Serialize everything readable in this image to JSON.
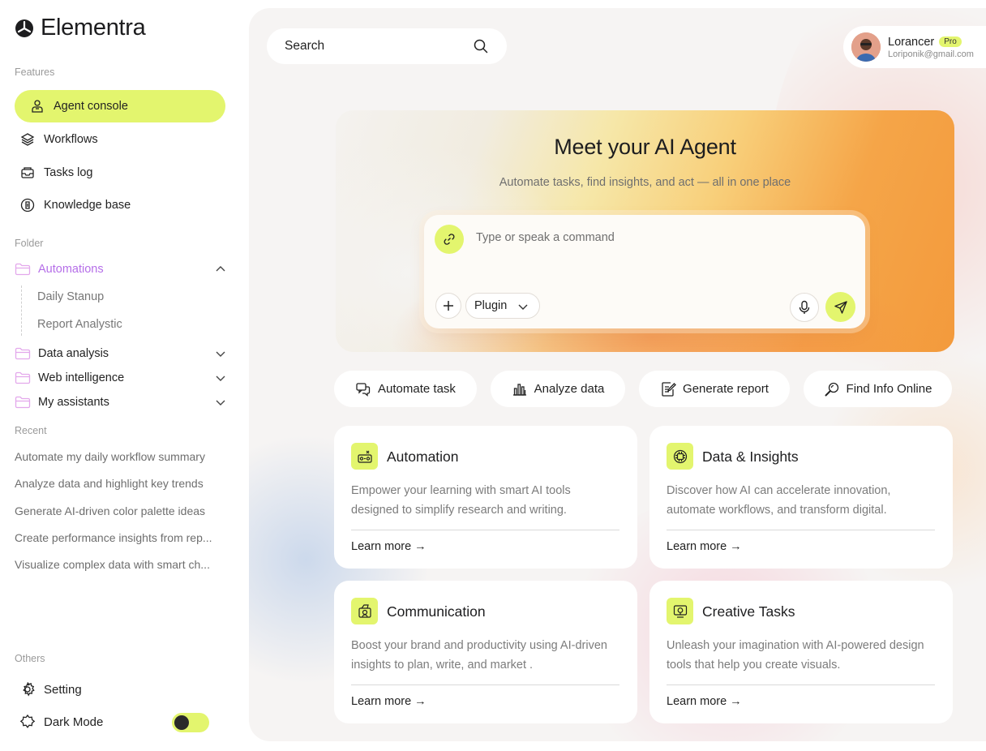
{
  "brand": {
    "name": "Elementra"
  },
  "sidebar": {
    "features_label": "Features",
    "features": [
      {
        "label": "Agent console",
        "icon": "agent-icon"
      },
      {
        "label": "Workflows",
        "icon": "layers-icon"
      },
      {
        "label": "Tasks log",
        "icon": "inbox-icon"
      },
      {
        "label": "Knowledge base",
        "icon": "book-icon"
      }
    ],
    "folder_label": "Folder",
    "folders": [
      {
        "label": "Automations",
        "open": true,
        "children": [
          "Daily Stanup",
          "Report Analystic"
        ]
      },
      {
        "label": "Data analysis",
        "open": false
      },
      {
        "label": "Web intelligence",
        "open": false
      },
      {
        "label": "My assistants",
        "open": false
      }
    ],
    "recent_label": "Recent",
    "recent": [
      "Automate my daily workflow summary",
      "Analyze data and highlight key trends",
      "Generate AI-driven color palette ideas",
      "Create performance insights from rep...",
      "Visualize complex data with smart ch..."
    ],
    "others_label": "Others",
    "setting_label": "Setting",
    "dark_mode_label": "Dark Mode",
    "dark_mode_on": false
  },
  "search": {
    "placeholder": "Search"
  },
  "profile": {
    "name": "Lorancer",
    "badge": "Pro",
    "email": "Loriponik@gmail.com"
  },
  "hero": {
    "title": "Meet your AI Agent",
    "subtitle": "Automate tasks, find insights, and act — all in one place",
    "input_placeholder": "Type or speak a command",
    "plugin_label": "Plugin"
  },
  "quick_actions": [
    {
      "label": "Automate task",
      "icon": "chat-icon"
    },
    {
      "label": "Analyze data",
      "icon": "bar-chart-icon"
    },
    {
      "label": "Generate report",
      "icon": "report-icon"
    },
    {
      "label": "Find Info Online",
      "icon": "search-globe-icon"
    }
  ],
  "cards": [
    {
      "title": "Automation",
      "desc": "Empower your learning with smart AI tools designed to simplify research and writing.",
      "link": "Learn more →",
      "icon": "automation-icon"
    },
    {
      "title": "Data & Insights",
      "desc": "Discover how AI can accelerate innovation, automate workflows, and transform digital.",
      "link": "Learn more →",
      "icon": "chip-icon"
    },
    {
      "title": "Communication",
      "desc": "Boost your brand and productivity using AI-driven insights to plan, write, and market .",
      "link": "Learn more →",
      "icon": "communication-icon"
    },
    {
      "title": "Creative Tasks",
      "desc": "Unleash your imagination with AI-powered design tools that help you create visuals.",
      "link": "Learn more →",
      "icon": "creative-icon"
    }
  ],
  "colors": {
    "accent": "#e3f56e",
    "folder_open": "#b56ee8",
    "hero_orange": "#f39a3c"
  }
}
